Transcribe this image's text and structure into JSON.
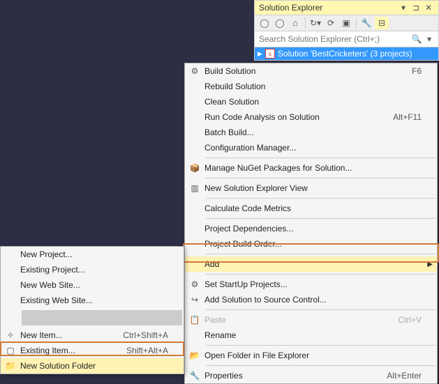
{
  "panel": {
    "title": "Solution Explorer",
    "search_placeholder": "Search Solution Explorer (Ctrl+;)",
    "selected_node": "Solution 'BestCricketers' (3 projects)"
  },
  "context_menu": [
    {
      "label": "Build Solution",
      "icon": "build-icon",
      "shortcut": ""
    },
    {
      "label": "Rebuild Solution"
    },
    {
      "label": "Clean Solution"
    },
    {
      "label": "Run Code Analysis on Solution",
      "shortcut": "Alt+F11"
    },
    {
      "label": "Batch Build..."
    },
    {
      "label": "Configuration Manager..."
    },
    {
      "sep": true
    },
    {
      "label": "Manage NuGet Packages for Solution...",
      "icon": "nuget-icon"
    },
    {
      "sep": true
    },
    {
      "label": "New Solution Explorer View",
      "icon": "new-view-icon"
    },
    {
      "sep": true
    },
    {
      "label": "Calculate Code Metrics"
    },
    {
      "sep": true
    },
    {
      "label": "Project Dependencies..."
    },
    {
      "label": "Project Build Order..."
    },
    {
      "sep": true
    },
    {
      "label": "Add",
      "submenu": true,
      "hover": true
    },
    {
      "sep": true
    },
    {
      "label": "Set StartUp Projects...",
      "icon": "gear-icon"
    },
    {
      "label": "Add Solution to Source Control...",
      "icon": "source-control-icon"
    },
    {
      "sep": true
    },
    {
      "label": "Paste",
      "icon": "paste-icon",
      "shortcut": "Ctrl+V",
      "disabled": true
    },
    {
      "label": "Rename"
    },
    {
      "sep": true
    },
    {
      "label": "Open Folder in File Explorer",
      "icon": "folder-open-icon"
    },
    {
      "sep": true
    },
    {
      "label": "Properties",
      "icon": "wrench-icon",
      "shortcut": "Alt+Enter"
    }
  ],
  "submenu": [
    {
      "label": "New Project..."
    },
    {
      "label": "Existing Project..."
    },
    {
      "label": "New Web Site..."
    },
    {
      "label": "Existing Web Site..."
    },
    {
      "sep": true
    },
    {
      "label": "New Item...",
      "icon": "new-item-icon",
      "shortcut": "Ctrl+Shift+A"
    },
    {
      "label": "Existing Item...",
      "icon": "existing-item-icon",
      "shortcut": "Shift+Alt+A"
    },
    {
      "label": "New Solution Folder",
      "icon": "new-folder-icon",
      "highlight": true
    }
  ],
  "shortcuts": {
    "build": "F6"
  }
}
